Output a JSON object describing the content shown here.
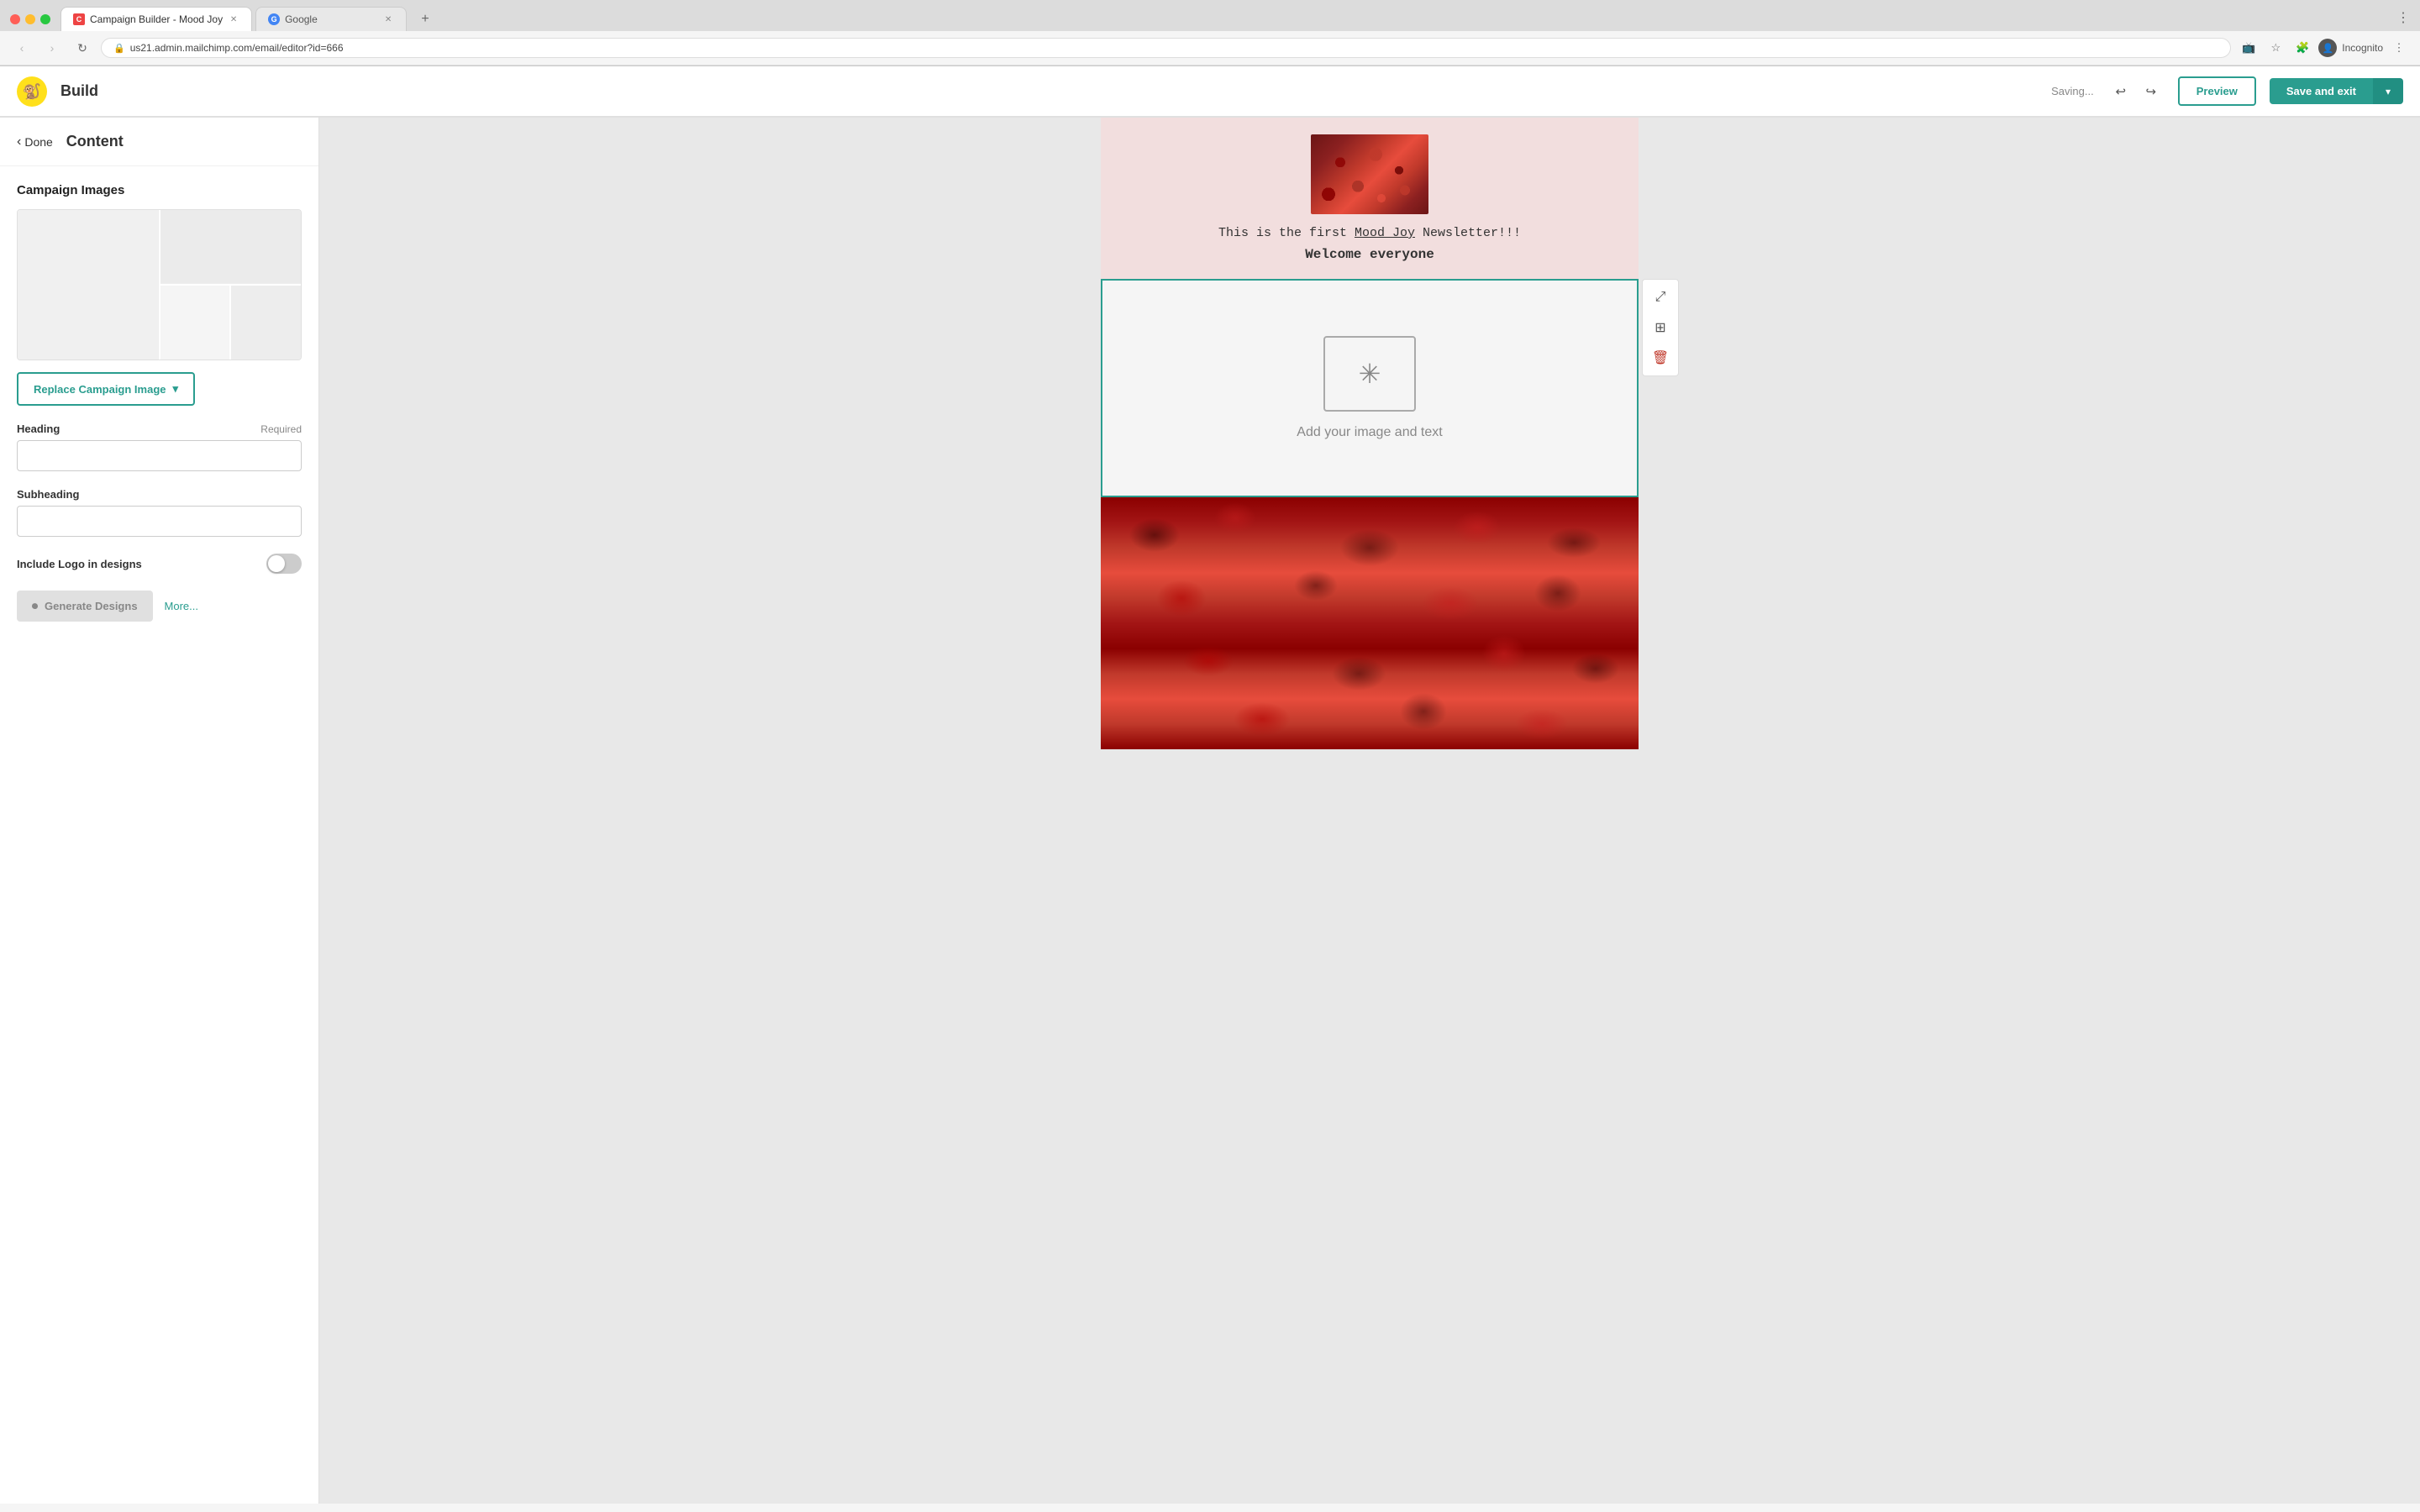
{
  "browser": {
    "tab1_title": "Campaign Builder - Mood Joy",
    "tab2_title": "Google",
    "address": "us21.admin.mailchimp.com/email/editor?id=666",
    "incognito_label": "Incognito"
  },
  "header": {
    "logo_alt": "Mailchimp",
    "build_label": "Build",
    "saving_label": "Saving...",
    "preview_label": "Preview",
    "save_exit_label": "Save and exit"
  },
  "sidebar": {
    "done_label": "Done",
    "content_title": "Content",
    "campaign_images_title": "Campaign Images",
    "replace_btn_label": "Replace Campaign Image",
    "heading_label": "Heading",
    "heading_required": "Required",
    "subheading_label": "Subheading",
    "logo_label": "Include Logo in designs",
    "generate_label": "Generate Designs",
    "more_label": "More..."
  },
  "email": {
    "first_line": "This is the first ",
    "mood_joy_link": "Mood Joy",
    "newsletter_suffix": " Newsletter!!!",
    "welcome_text": "Welcome everyone",
    "add_image_text": "Add your image and text",
    "campaign_name": "Mood Joy"
  }
}
